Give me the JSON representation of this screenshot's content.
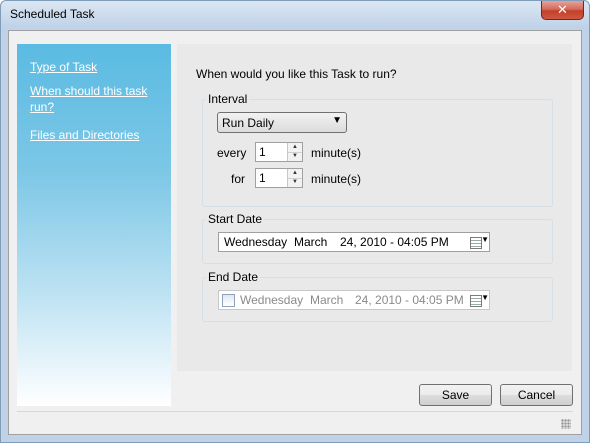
{
  "window": {
    "title": "Scheduled Task",
    "close_glyph": "✕"
  },
  "sidebar": {
    "items": [
      {
        "label": "Type of Task"
      },
      {
        "label": "When should this task run?"
      },
      {
        "label": "Files and Directories"
      }
    ]
  },
  "main": {
    "question": "When would you like this Task to run?",
    "interval": {
      "label": "Interval",
      "frequency": "Run Daily",
      "every_label": "every",
      "every_value": "1",
      "every_unit": "minute(s)",
      "for_label": "for",
      "for_value": "1",
      "for_unit": "minute(s)"
    },
    "start_date": {
      "label": "Start Date",
      "weekday": "Wednesday",
      "month": "March",
      "rest": "24, 2010 - 04:05 PM"
    },
    "end_date": {
      "label": "End Date",
      "weekday": "Wednesday",
      "month": "March",
      "rest": "24, 2010 - 04:05 PM"
    }
  },
  "buttons": {
    "save": "Save",
    "cancel": "Cancel"
  },
  "icons": {
    "close": "close-icon",
    "dropdown": "chevron-down-icon",
    "spin_up": "spin-up-icon",
    "spin_down": "spin-down-icon",
    "calendar": "calendar-icon",
    "checkbox": "checkbox-icon",
    "resize": "resize-grip-icon"
  },
  "colors": {
    "sidebar_top": "#5bbbe2",
    "link": "#ffffff",
    "close_button": "#c2402d"
  }
}
